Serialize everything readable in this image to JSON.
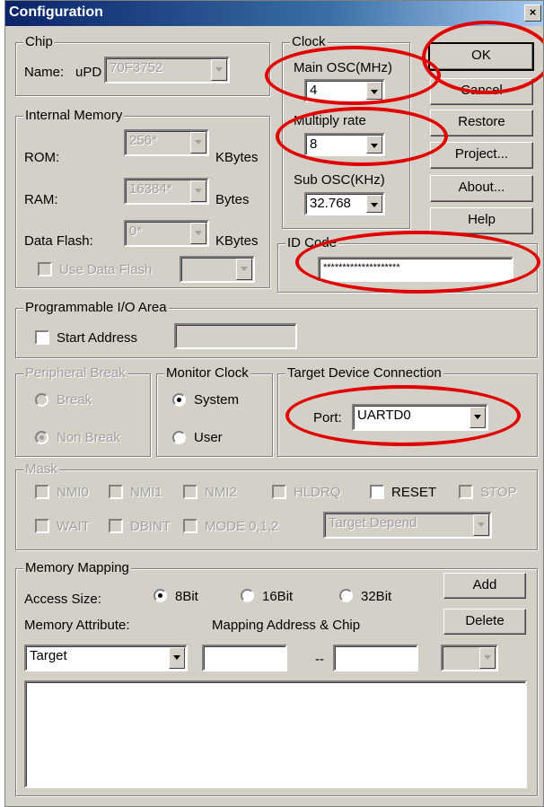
{
  "window": {
    "title": "Configuration",
    "close_glyph": "×"
  },
  "chip": {
    "legend": "Chip",
    "name_label": "Name:",
    "name_prefix": "uPD",
    "name_value": "70F3752"
  },
  "internal_memory": {
    "legend": "Internal Memory",
    "rom_label": "ROM:",
    "rom_value": "256*",
    "rom_unit": "KBytes",
    "ram_label": "RAM:",
    "ram_value": "16384*",
    "ram_unit": "Bytes",
    "flash_label": "Data Flash:",
    "flash_value": "0*",
    "flash_unit": "KBytes",
    "use_flash_label": "Use Data Flash"
  },
  "clock": {
    "legend": "Clock",
    "main_osc_label": "Main OSC(MHz)",
    "main_osc_value": "4",
    "multiply_label": "Multiply rate",
    "multiply_value": "8",
    "sub_osc_label": "Sub OSC(KHz)",
    "sub_osc_value": "32.768"
  },
  "buttons": {
    "ok": "OK",
    "cancel": "Cancel",
    "restore": "Restore",
    "project": "Project...",
    "about": "About...",
    "help": "Help"
  },
  "id_code": {
    "legend": "ID Code",
    "value": "********************"
  },
  "programmable_io": {
    "legend": "Programmable I/O Area",
    "start_address_label": "Start Address",
    "start_address_value": ""
  },
  "peripheral_break": {
    "legend": "Peripheral Break",
    "break_label": "Break",
    "non_break_label": "Non Break",
    "selected": "Non Break"
  },
  "monitor_clock": {
    "legend": "Monitor Clock",
    "system_label": "System",
    "user_label": "User",
    "selected": "System"
  },
  "target_device": {
    "legend": "Target Device Connection",
    "port_label": "Port:",
    "port_value": "UARTD0"
  },
  "mask": {
    "legend": "Mask",
    "row1": [
      "NMI0",
      "NMI1",
      "NMI2",
      "HLDRQ",
      "RESET",
      "STOP"
    ],
    "row2": [
      "WAIT",
      "DBINT",
      "MODE 0,1,2"
    ],
    "mode_value": "Target Depend"
  },
  "memory_mapping": {
    "legend": "Memory Mapping",
    "access_size_label": "Access Size:",
    "sizes": [
      "8Bit",
      "16Bit",
      "32Bit"
    ],
    "selected_size": "8Bit",
    "add_label": "Add",
    "delete_label": "Delete",
    "attribute_label": "Memory Attribute:",
    "attribute_value": "Target",
    "address_label": "Mapping Address & Chip",
    "range_separator": "--"
  },
  "annotation_color": "#e00000"
}
